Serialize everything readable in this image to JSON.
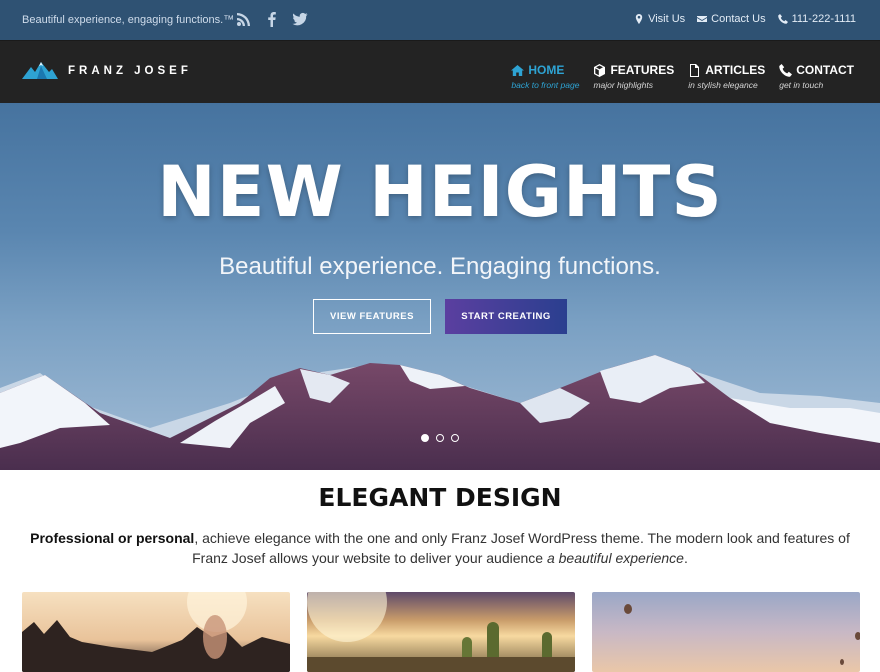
{
  "topbar": {
    "tagline": "Beautiful experience, engaging functions.™",
    "social": [
      "rss-icon",
      "facebook-icon",
      "twitter-icon"
    ],
    "visit_us": "Visit Us",
    "contact_us": "Contact Us",
    "phone": "111-222-1111"
  },
  "logo": {
    "text": "FRANZ JOSEF"
  },
  "menu": [
    {
      "label": "HOME",
      "sub": "back to front page",
      "icon": "home-icon",
      "active": true
    },
    {
      "label": "FEATURES",
      "sub": "major highlights",
      "icon": "cube-icon"
    },
    {
      "label": "ARTICLES",
      "sub": "in stylish elegance",
      "icon": "document-icon"
    },
    {
      "label": "CONTACT",
      "sub": "get in touch",
      "icon": "phone-icon"
    }
  ],
  "hero": {
    "title": "NEW HEIGHTS",
    "subtitle": "Beautiful experience. Engaging functions.",
    "btn_features": "VIEW FEATURES",
    "btn_create": "START CREATING",
    "slides": 3,
    "active_slide": 1
  },
  "section": {
    "title": "ELEGANT DESIGN",
    "intro_bold": "Professional or personal",
    "intro_text": ", achieve elegance with the one and only Franz Josef WordPress theme. The modern look and features of Franz Josef allows your website to deliver your audience ",
    "intro_italic": "a beautiful experience",
    "intro_end": "."
  },
  "colors": {
    "topbar": "#2f5273",
    "nav": "#232323",
    "accent": "#2ea3d3",
    "button_gradient": [
      "#5b3fa0",
      "#2a3f8f"
    ]
  }
}
